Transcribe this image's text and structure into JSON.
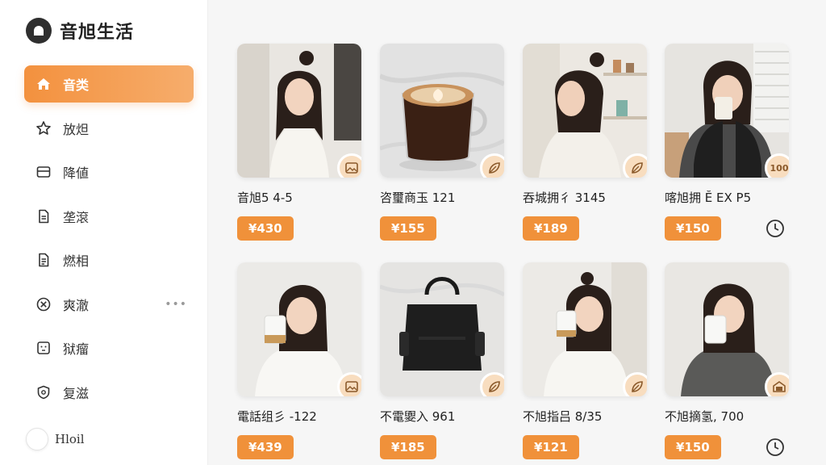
{
  "app": {
    "name": "音旭生活"
  },
  "sidebar": {
    "items": [
      {
        "label": "音类",
        "icon": "home-icon",
        "active": true
      },
      {
        "label": "放炟",
        "icon": "star-icon"
      },
      {
        "label": "降値",
        "icon": "inbox-icon"
      },
      {
        "label": "垄滾",
        "icon": "document-icon"
      },
      {
        "label": "燃相",
        "icon": "document-lines-icon"
      },
      {
        "label": "爽澈",
        "icon": "circle-x-icon",
        "more": "•••"
      },
      {
        "label": "狱瘤",
        "icon": "face-icon"
      },
      {
        "label": "复滋",
        "icon": "shield-icon"
      }
    ],
    "user": {
      "name": "Hloil"
    }
  },
  "products": [
    {
      "title": "音旭5 4-5",
      "price": "¥430",
      "badge": "image-icon"
    },
    {
      "title": "咨璽商玉 121",
      "price": "¥155",
      "badge": "leaf-icon"
    },
    {
      "title": "吞城拥彳 3145",
      "price": "¥189",
      "badge": "leaf-icon"
    },
    {
      "title": "喀旭拥 Ĕ EX P5",
      "price": "¥150",
      "badge_text": "100",
      "clock": true
    },
    {
      "title": "電話组彡 -122",
      "price": "¥439",
      "badge": "image-icon"
    },
    {
      "title": "不電夓入 961",
      "price": "¥185",
      "badge": "leaf-icon"
    },
    {
      "title": "不旭指吕 8/35",
      "price": "¥121",
      "badge": "leaf-icon"
    },
    {
      "title": "不旭摘氢, 700",
      "price": "¥150",
      "badge": "frame-icon",
      "clock": true
    }
  ],
  "colors": {
    "accent": "#f0913a",
    "badge_bg": "#f8ddbf"
  }
}
